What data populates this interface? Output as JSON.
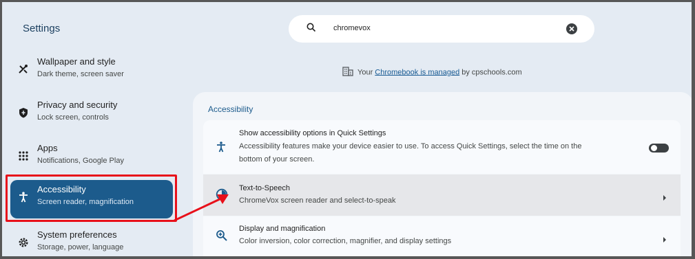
{
  "app": {
    "title": "Settings"
  },
  "search": {
    "query": "chromevox"
  },
  "sidebar": {
    "items": [
      {
        "label": "Wallpaper and style",
        "sub": "Dark theme, screen saver",
        "icon": "palette-icon"
      },
      {
        "label": "Privacy and security",
        "sub": "Lock screen, controls",
        "icon": "shield-icon"
      },
      {
        "label": "Apps",
        "sub": "Notifications, Google Play",
        "icon": "apps-grid-icon"
      },
      {
        "label": "Accessibility",
        "sub": "Screen reader, magnification",
        "icon": "accessibility-icon",
        "selected": true
      },
      {
        "label": "System preferences",
        "sub": "Storage, power, language",
        "icon": "gear-icon"
      }
    ]
  },
  "managed": {
    "prefix": "Your ",
    "link": "Chromebook is managed",
    "suffix": " by cpschools.com"
  },
  "section": {
    "title": "Accessibility",
    "rows": [
      {
        "title": "Show accessibility options in Quick Settings",
        "sub_line1": "Accessibility features make your device easier to use. To access Quick Settings, select the time on the",
        "sub_line2": "bottom of your screen.",
        "icon": "accessibility-icon",
        "control": "toggle",
        "toggle_on": false
      },
      {
        "title": "Text-to-Speech",
        "sub": "ChromeVox screen reader and select-to-speak",
        "icon": "text-to-speech-icon",
        "control": "chevron"
      },
      {
        "title": "Display and magnification",
        "sub": "Color inversion, color correction, magnifier, and display settings",
        "icon": "zoom-in-icon",
        "control": "chevron"
      }
    ]
  },
  "colors": {
    "background": "#e4ebf3",
    "accent": "#1c5b8c",
    "annotation": "#e8101a"
  }
}
